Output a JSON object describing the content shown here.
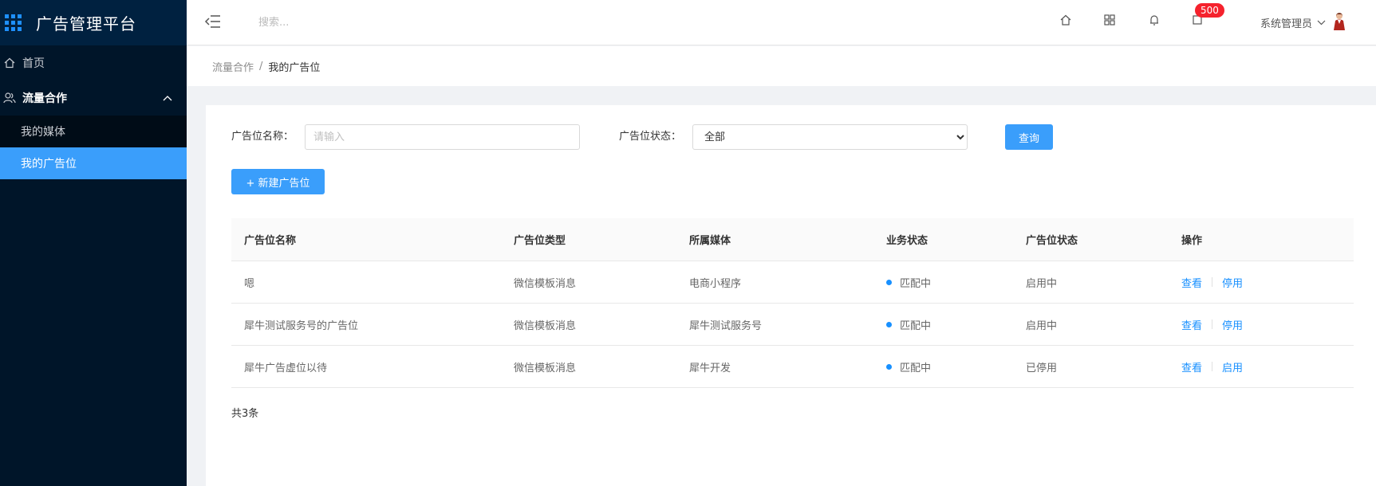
{
  "sidebar": {
    "title": "广告管理平台",
    "home": "首页",
    "group": "流量合作",
    "sub_items": [
      {
        "label": "我的媒体",
        "active": false
      },
      {
        "label": "我的广告位",
        "active": true
      }
    ]
  },
  "header": {
    "search_placeholder": "搜索...",
    "badge": "500",
    "user": "系统管理员",
    "icons": [
      "home-icon",
      "apps-icon",
      "bell-icon",
      "message-icon"
    ]
  },
  "breadcrumb": {
    "parent": "流量合作",
    "separator": "/",
    "current": "我的广告位"
  },
  "filters": {
    "name_label": "广告位名称：",
    "name_placeholder": "请输入",
    "status_label": "广告位状态：",
    "status_value": "全部",
    "query_button": "查询",
    "new_button": "+ 新建广告位"
  },
  "table": {
    "columns": [
      "广告位名称",
      "广告位类型",
      "所属媒体",
      "业务状态",
      "广告位状态",
      "操作"
    ],
    "rows": [
      {
        "name": "嗯",
        "type": "微信模板消息",
        "media": "电商小程序",
        "biz_status": "匹配中",
        "status": "启用中",
        "op1": "查看",
        "op2": "停用"
      },
      {
        "name": "犀牛测试服务号的广告位",
        "type": "微信模板消息",
        "media": "犀牛测试服务号",
        "biz_status": "匹配中",
        "status": "启用中",
        "op1": "查看",
        "op2": "停用"
      },
      {
        "name": "犀牛广告虚位以待",
        "type": "微信模板消息",
        "media": "犀牛开发",
        "biz_status": "匹配中",
        "status": "已停用",
        "op1": "查看",
        "op2": "启用"
      }
    ]
  },
  "footer": {
    "total": "共3条"
  },
  "colors": {
    "sidebar_bg": "#001529",
    "primary": "#3a9efb",
    "link": "#1890ff",
    "badge": "#f5222d"
  }
}
